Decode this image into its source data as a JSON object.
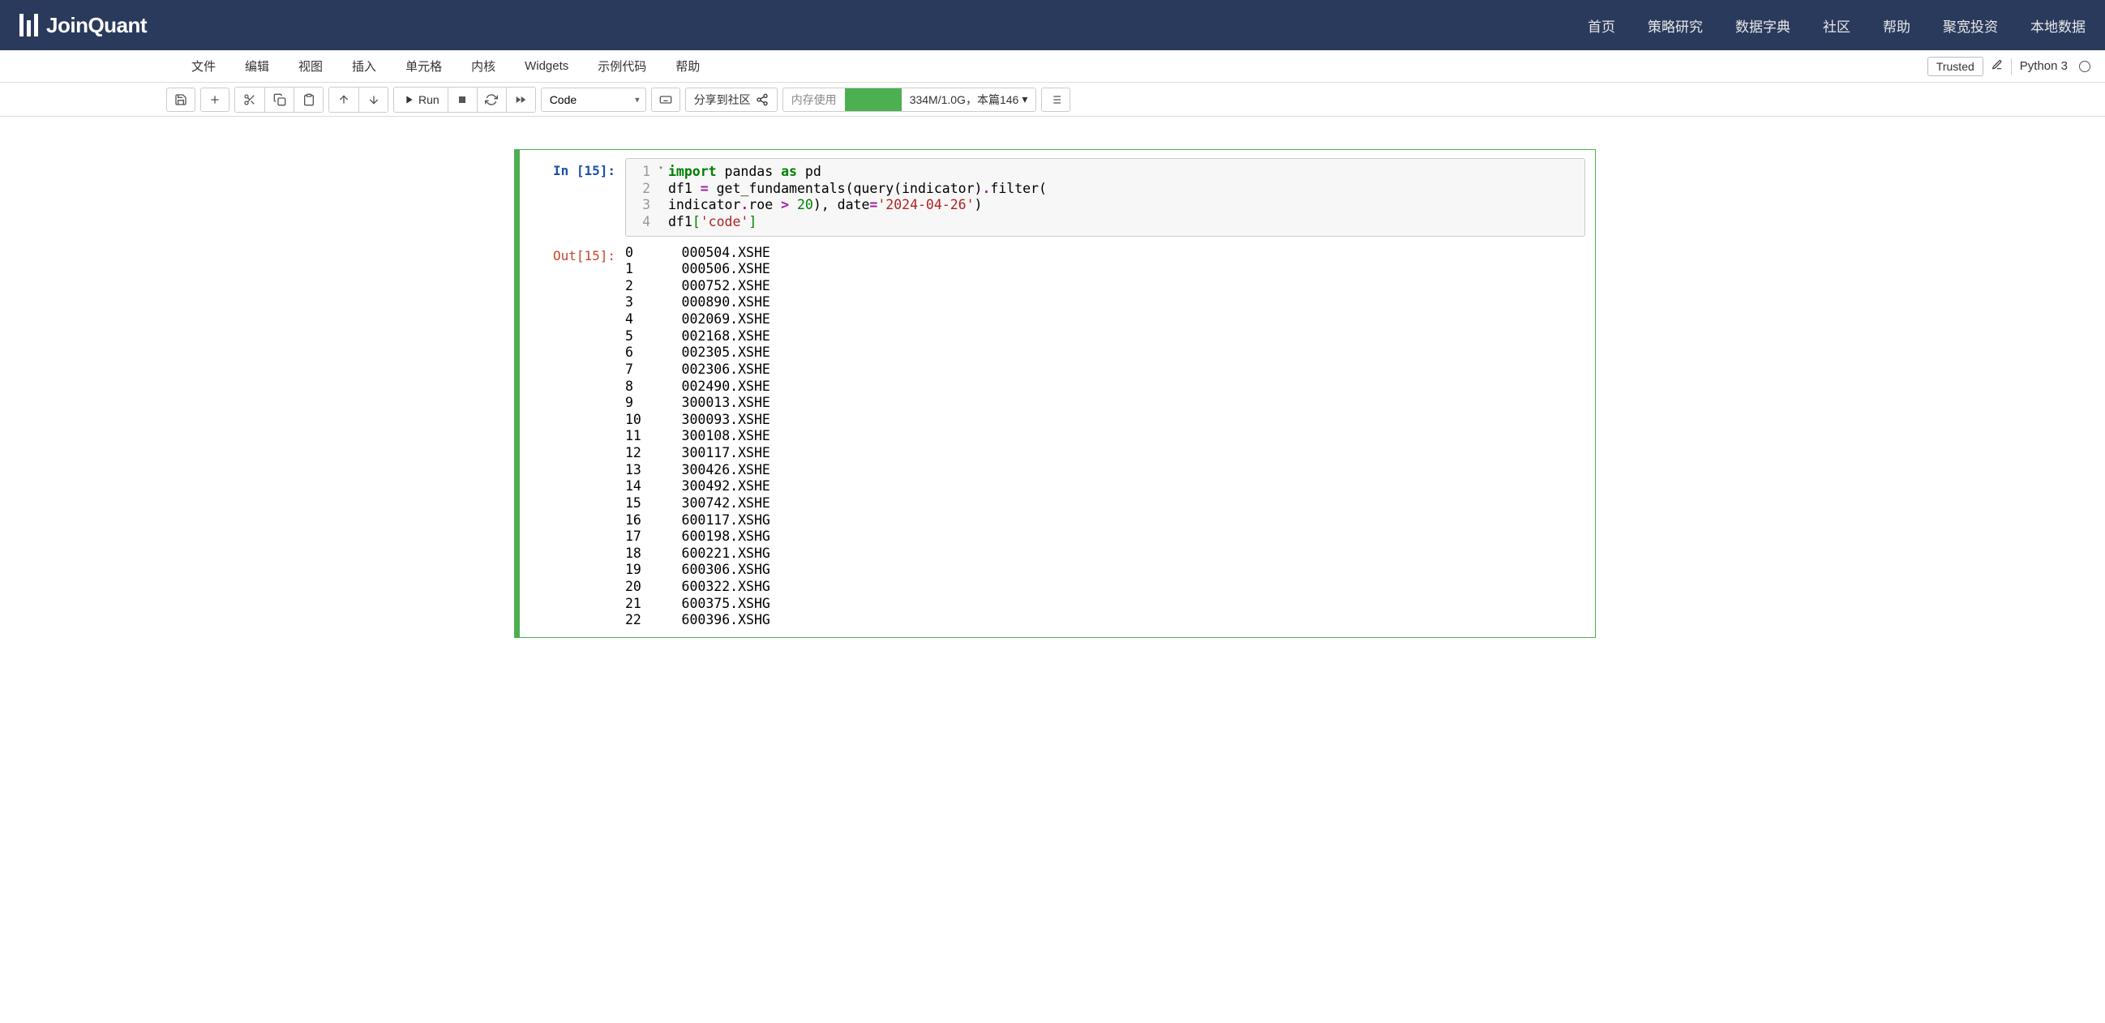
{
  "brand": {
    "name": "JoinQuant"
  },
  "nav": {
    "items": [
      "首页",
      "策略研究",
      "数据字典",
      "社区",
      "帮助",
      "聚宽投资",
      "本地数据"
    ]
  },
  "menubar": {
    "items": [
      "文件",
      "编辑",
      "视图",
      "插入",
      "单元格",
      "内核",
      "Widgets",
      "示例代码",
      "帮助"
    ],
    "trusted": "Trusted",
    "kernel": "Python 3"
  },
  "toolbar": {
    "run_label": "Run",
    "celltype": "Code",
    "share_label": "分享到社区",
    "memory": {
      "label": "内存使用",
      "text": "334M/1.0G，本篇146"
    }
  },
  "cell": {
    "in_prompt": "In [15]:",
    "out_prompt": "Out[15]:",
    "code": {
      "line1_nums": [
        "1",
        "2",
        "3",
        "4"
      ],
      "l1_import": "import",
      "l1_pandas": " pandas ",
      "l1_as": "as",
      "l1_pd": " pd",
      "l2_a": "df1 ",
      "l2_eq": "=",
      "l2_b": " get_fundamentals(query(indicator)",
      "l2_dot": ".",
      "l2_c": "filter(",
      "l3_a": "indicator",
      "l3_dot": ".",
      "l3_b": "roe ",
      "l3_gt": ">",
      "l3_sp": " ",
      "l3_20": "20",
      "l3_c": "), date",
      "l3_eq": "=",
      "l3_date": "'2024-04-26'",
      "l3_close": ")",
      "l4_a": "df1",
      "l4_open": "[",
      "l4_code": "'code'",
      "l4_close": "]"
    },
    "output_rows": [
      {
        "idx": "0",
        "val": "000504.XSHE"
      },
      {
        "idx": "1",
        "val": "000506.XSHE"
      },
      {
        "idx": "2",
        "val": "000752.XSHE"
      },
      {
        "idx": "3",
        "val": "000890.XSHE"
      },
      {
        "idx": "4",
        "val": "002069.XSHE"
      },
      {
        "idx": "5",
        "val": "002168.XSHE"
      },
      {
        "idx": "6",
        "val": "002305.XSHE"
      },
      {
        "idx": "7",
        "val": "002306.XSHE"
      },
      {
        "idx": "8",
        "val": "002490.XSHE"
      },
      {
        "idx": "9",
        "val": "300013.XSHE"
      },
      {
        "idx": "10",
        "val": "300093.XSHE"
      },
      {
        "idx": "11",
        "val": "300108.XSHE"
      },
      {
        "idx": "12",
        "val": "300117.XSHE"
      },
      {
        "idx": "13",
        "val": "300426.XSHE"
      },
      {
        "idx": "14",
        "val": "300492.XSHE"
      },
      {
        "idx": "15",
        "val": "300742.XSHE"
      },
      {
        "idx": "16",
        "val": "600117.XSHG"
      },
      {
        "idx": "17",
        "val": "600198.XSHG"
      },
      {
        "idx": "18",
        "val": "600221.XSHG"
      },
      {
        "idx": "19",
        "val": "600306.XSHG"
      },
      {
        "idx": "20",
        "val": "600322.XSHG"
      },
      {
        "idx": "21",
        "val": "600375.XSHG"
      },
      {
        "idx": "22",
        "val": "600396.XSHG"
      }
    ]
  }
}
